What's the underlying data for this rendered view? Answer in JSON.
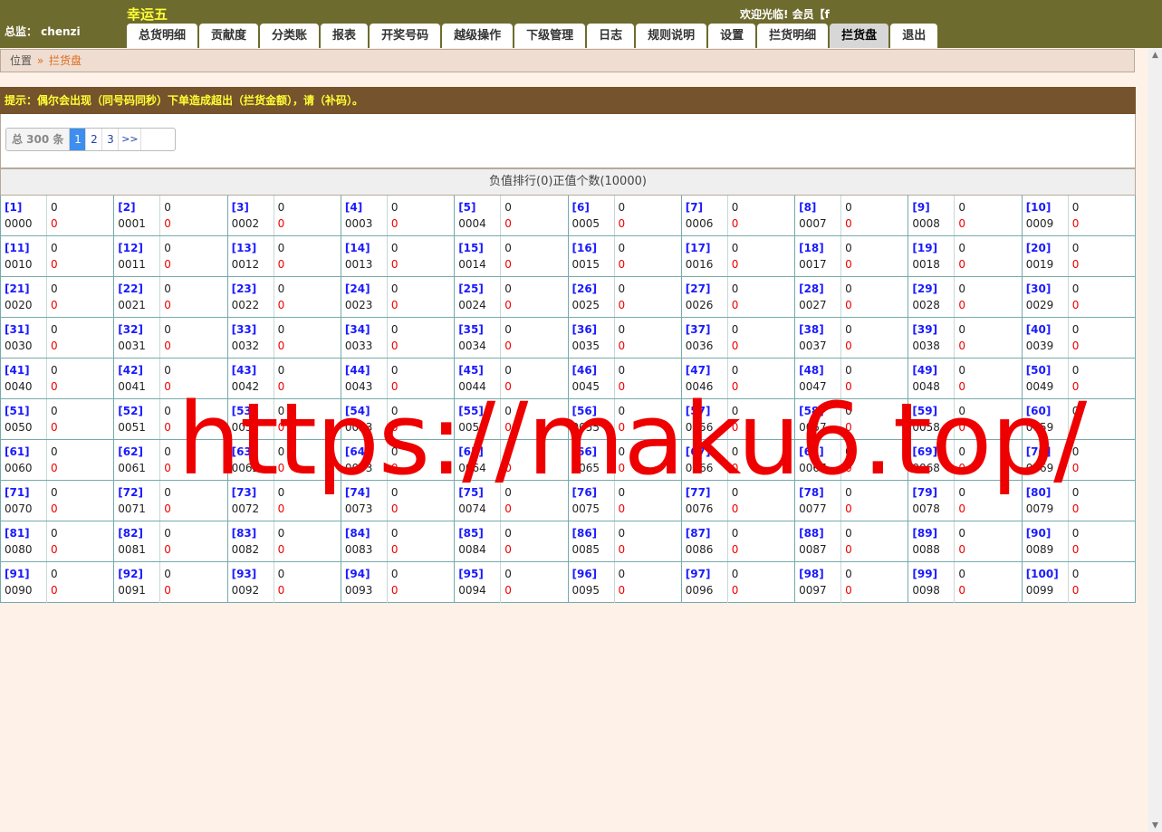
{
  "header": {
    "brand": "幸运五",
    "admin": "总监： chenzi",
    "welcome": "欢迎光临! 会员【f",
    "nav": [
      {
        "label": "总货明细"
      },
      {
        "label": "贡献度"
      },
      {
        "label": "分类账"
      },
      {
        "label": "报表"
      },
      {
        "label": "开奖号码"
      },
      {
        "label": "越级操作"
      },
      {
        "label": "下级管理"
      },
      {
        "label": "日志"
      },
      {
        "label": "规则说明"
      },
      {
        "label": "设置"
      },
      {
        "label": "拦货明细"
      },
      {
        "label": "拦货盘",
        "active": true
      },
      {
        "label": "退出"
      }
    ]
  },
  "breadcrumb": {
    "label": "位置",
    "separator": "»",
    "current": "拦货盘"
  },
  "notice": "提示：偶尔会出现（同号码同秒）下单造成超出（拦货金额），请（补码）。",
  "pager": {
    "total": "总 300 条",
    "pages": [
      "1",
      "2",
      "3"
    ],
    "active_page": "1",
    "next": ">>"
  },
  "stats": "负值排行(0)正值个数(10000)",
  "grid": {
    "count": 100,
    "value": "0",
    "red_value": "0",
    "rank_format": "[n]",
    "number_digits": 4
  },
  "watermark": "https://maku6.top/",
  "scrollbar": {
    "up": "▲",
    "down": "▼"
  },
  "colors": {
    "header_bg": "#6e6b2e",
    "notice_bg": "#75532d",
    "page_bg": "#fdf1e8",
    "rank_link": "#1a1aff",
    "negative_red": "#ee0000"
  }
}
